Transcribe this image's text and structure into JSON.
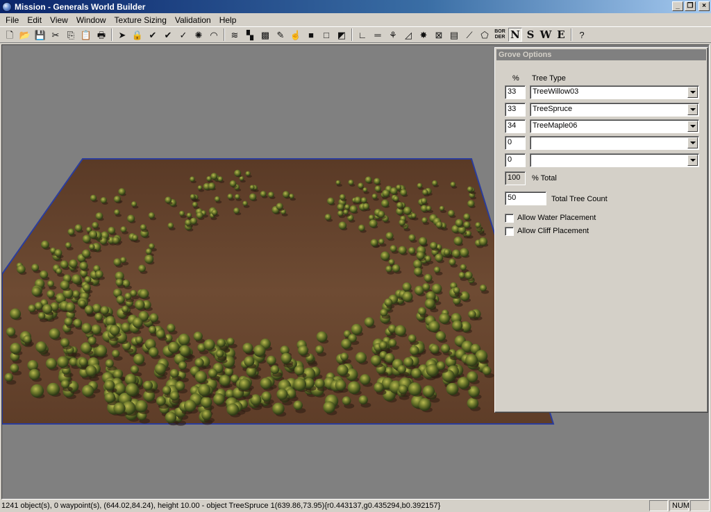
{
  "window": {
    "title": "Mission - Generals World Builder",
    "controls": [
      "minimize",
      "maximize",
      "close"
    ]
  },
  "menu": [
    "File",
    "Edit",
    "View",
    "Window",
    "Texture Sizing",
    "Validation",
    "Help"
  ],
  "toolbar": {
    "buttons": [
      {
        "name": "new-icon",
        "glyph": "🗋"
      },
      {
        "name": "open-icon",
        "glyph": "📂"
      },
      {
        "name": "save-icon",
        "glyph": "💾"
      },
      {
        "name": "cut-icon",
        "glyph": "✂"
      },
      {
        "name": "copy-icon",
        "glyph": "⎘"
      },
      {
        "name": "paste-icon",
        "glyph": "📋"
      },
      {
        "name": "print-icon",
        "glyph": "🖶"
      },
      {
        "name": "pointer-icon",
        "glyph": "➤"
      },
      {
        "name": "lock-icon",
        "glyph": "🔒"
      },
      {
        "name": "brush-icon",
        "glyph": "✔"
      },
      {
        "name": "multi-brush-icon",
        "glyph": "✔"
      },
      {
        "name": "smooth-brush-icon",
        "glyph": "✓"
      },
      {
        "name": "star-icon",
        "glyph": "✺"
      },
      {
        "name": "dome-icon",
        "glyph": "◠"
      },
      {
        "name": "water-icon",
        "glyph": "≋"
      },
      {
        "name": "tile-icon",
        "glyph": "▚"
      },
      {
        "name": "checker-icon",
        "glyph": "▩"
      },
      {
        "name": "eyedropper-icon",
        "glyph": "✎"
      },
      {
        "name": "hand-icon",
        "glyph": "☝"
      },
      {
        "name": "black-square-icon",
        "glyph": "■"
      },
      {
        "name": "gray-square-icon",
        "glyph": "□"
      },
      {
        "name": "gradient-icon",
        "glyph": "◩"
      },
      {
        "name": "axes-icon",
        "glyph": "∟"
      },
      {
        "name": "ruler-icon",
        "glyph": "═"
      },
      {
        "name": "tree-icon",
        "glyph": "⚘"
      },
      {
        "name": "ramp-icon",
        "glyph": "◿"
      },
      {
        "name": "splat-icon",
        "glyph": "✸"
      },
      {
        "name": "grid-box-icon",
        "glyph": "⊠"
      },
      {
        "name": "road-icon",
        "glyph": "▤"
      },
      {
        "name": "waypoint-icon",
        "glyph": "⟋"
      },
      {
        "name": "polygon-icon",
        "glyph": "⬠"
      }
    ],
    "border_label": "BOR DER",
    "direction_letters": [
      "N",
      "S",
      "W",
      "E"
    ],
    "active_direction": "N",
    "help_glyph": "?"
  },
  "grove": {
    "title": "Grove Options",
    "percent_header": "%",
    "type_header": "Tree Type",
    "rows": [
      {
        "percent": "33",
        "type": "TreeWillow03"
      },
      {
        "percent": "33",
        "type": "TreeSpruce"
      },
      {
        "percent": "34",
        "type": "TreeMaple06"
      },
      {
        "percent": "0",
        "type": ""
      },
      {
        "percent": "0",
        "type": ""
      }
    ],
    "total_value": "100",
    "total_label": "% Total",
    "tree_count_value": "50",
    "tree_count_label": "Total Tree Count",
    "allow_water_label": "Allow Water Placement",
    "allow_water_checked": false,
    "allow_cliff_label": "Allow Cliff Placement",
    "allow_cliff_checked": false
  },
  "status": {
    "message": "1241 object(s), 0 waypoint(s), (644.02,84.24), height 10.00 - object TreeSpruce 1(639.86,73.95){r0.443137,g0.435294,b0.392157}",
    "num_indicator": "NUM"
  },
  "colors": {
    "title_start": "#0a246a",
    "title_end": "#a6caf0",
    "face": "#d4d0c8",
    "viewport": "#808080",
    "terrain": "#6b4a33",
    "map_border": "#2a3c9c"
  }
}
